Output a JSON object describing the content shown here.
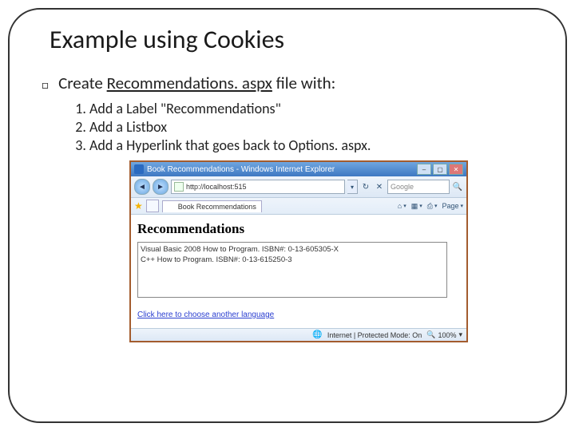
{
  "title": "Example using Cookies",
  "bullet": {
    "prefix": "Create ",
    "filename": "Recommendations. aspx",
    "suffix": " file with:"
  },
  "steps": [
    "Add a Label \"Recommendations\"",
    "Add a Listbox",
    "Add a Hyperlink that goes back to Options. aspx."
  ],
  "browser": {
    "window_title": "Book Recommendations - Windows Internet Explorer",
    "address": "http://localhost:515",
    "search_placeholder": "Google",
    "tab_label": "Book Recommendations",
    "page_menu": "Page",
    "page_heading": "Recommendations",
    "list_items": [
      "Visual Basic 2008 How to Program. ISBN#: 0-13-605305-X",
      "C++ How to Program. ISBN#: 0-13-615250-3"
    ],
    "link_text": "Click here to choose another language",
    "status_text": "Internet | Protected Mode: On",
    "zoom": "100%"
  }
}
